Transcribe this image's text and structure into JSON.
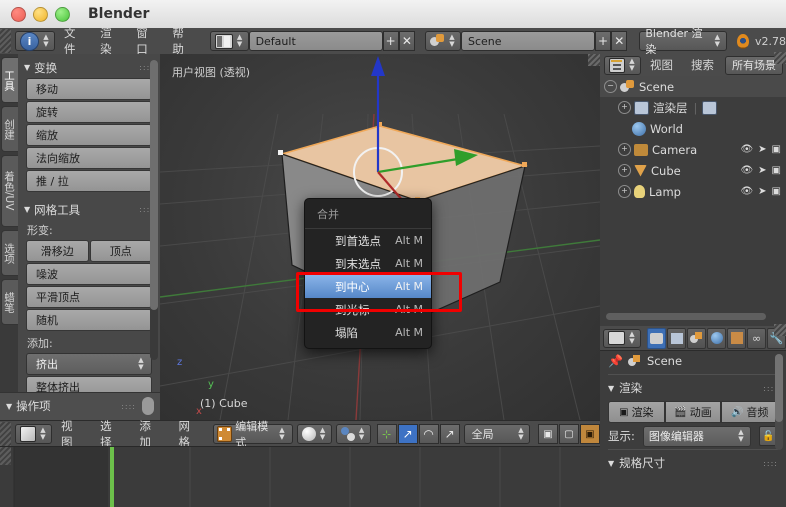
{
  "window": {
    "title": "Blender",
    "traffic_lights": [
      "close",
      "minimize",
      "zoom"
    ]
  },
  "info_header": {
    "editor_icon": "info-editor-icon",
    "menus": [
      "文件",
      "渲染",
      "窗口",
      "帮助"
    ],
    "screen_layout": {
      "icon": "screen-layout-icon",
      "value": "Default",
      "add_label": "+",
      "remove_label": "✕"
    },
    "scene": {
      "icon": "scene-icon",
      "value": "Scene",
      "add_label": "+",
      "remove_label": "✕"
    },
    "render_engine": "Blender 渲染",
    "blender_logo": "blender-logo-icon",
    "version": "v2.78"
  },
  "toolshelf": {
    "tabs": [
      {
        "label": "工具",
        "active": true
      },
      {
        "label": "创建",
        "active": false
      },
      {
        "label": "着色/UV",
        "active": false
      },
      {
        "label": "选项",
        "active": false
      },
      {
        "label": "蜡笔",
        "active": false
      }
    ],
    "sections": [
      {
        "title": "变换",
        "buttons": [
          "移动",
          "旋转",
          "缩放",
          "法向缩放",
          "推 / 拉"
        ]
      },
      {
        "title": "网格工具",
        "sub_label": "形变:",
        "pair": [
          "滑移边",
          "顶点"
        ],
        "buttons": [
          "噪波",
          "平滑顶点",
          "随机"
        ],
        "sub_label2": "添加:",
        "dropdown": "挤出",
        "buttons2": [
          "整体挤出"
        ]
      }
    ],
    "operator_panel": "操作项"
  },
  "viewport": {
    "view_label": "用户视图 (透视)",
    "object_label": "(1) Cube",
    "axis_gizmo": {
      "z": "z",
      "y": "y",
      "x": "x"
    }
  },
  "popup_menu": {
    "title": "合并",
    "items": [
      {
        "label": "到首选点",
        "shortcut": "Alt M",
        "highlighted": false
      },
      {
        "label": "到末选点",
        "shortcut": "Alt M",
        "highlighted": false
      },
      {
        "label": "到中心",
        "shortcut": "Alt M",
        "highlighted": true
      },
      {
        "label": "到光标",
        "shortcut": "Alt M",
        "highlighted": false
      },
      {
        "label": "塌陷",
        "shortcut": "Alt M",
        "highlighted": false
      }
    ],
    "annotation_color": "#f00000",
    "highlight_color": "#5687c8"
  },
  "viewport_footer": {
    "editor_icon": "3d-view-icon",
    "menus": [
      "视图",
      "选择",
      "添加",
      "网格"
    ],
    "mode": {
      "icon": "edit-mode-icon",
      "value": "编辑模式"
    },
    "shading": "shading-solid-icon",
    "pivot": "pivot-median-icon",
    "manipulator_icons": [
      "manipulator-axis-icon",
      "translate-manipulator-icon",
      "rotate-manipulator-icon",
      "scale-manipulator-icon"
    ],
    "orientation": "全局",
    "layer_icons": [
      "occlude-geometry-icon",
      "limit-selection-icon",
      "mesh-display-icon"
    ]
  },
  "outliner": {
    "editor_icon": "outliner-icon",
    "menus": [
      "视图",
      "搜索"
    ],
    "display_mode": "所有场景",
    "rows": [
      {
        "label": "Scene",
        "icon": "scene-icon",
        "indent": 0,
        "expander": "minus",
        "selected": true
      },
      {
        "label": "渲染层",
        "icon": "renderlayer-icon",
        "indent": 1,
        "expander": "plus",
        "selected": false
      },
      {
        "label": "World",
        "icon": "world-icon",
        "indent": 1,
        "expander": "none",
        "selected": false
      },
      {
        "label": "Camera",
        "icon": "camera-icon",
        "indent": 1,
        "expander": "plus",
        "selected": false
      },
      {
        "label": "Cube",
        "icon": "mesh-icon",
        "indent": 1,
        "expander": "plus",
        "selected": false
      },
      {
        "label": "Lamp",
        "icon": "lamp-icon",
        "indent": 1,
        "expander": "plus",
        "selected": false
      }
    ],
    "row_toggles": [
      "eye-icon",
      "cursor-arrow-icon",
      "camera-render-icon"
    ]
  },
  "properties": {
    "editor_icon": "properties-icon",
    "tabs": [
      {
        "name": "render-tab-icon",
        "active": true
      },
      {
        "name": "render-layers-tab-icon",
        "active": false
      },
      {
        "name": "scene-tab-icon",
        "active": false
      },
      {
        "name": "world-tab-icon",
        "active": false
      },
      {
        "name": "object-tab-icon",
        "active": false
      },
      {
        "name": "constraints-tab-icon",
        "active": false
      },
      {
        "name": "modifiers-tab-icon",
        "active": false
      }
    ],
    "breadcrumb": {
      "pin_icon": "pin-icon",
      "scene_icon": "scene-icon",
      "label": "Scene"
    },
    "render_section": {
      "title": "渲染",
      "buttons": [
        {
          "label": "渲染",
          "icon": "render-image-icon"
        },
        {
          "label": "动画",
          "icon": "render-animation-icon"
        },
        {
          "label": "音频",
          "icon": "render-audio-icon"
        }
      ],
      "display_label": "显示:",
      "display_value": "图像编辑器",
      "lock_icon": "lock-icon"
    },
    "dimensions_section": {
      "title": "规格尺寸"
    }
  }
}
